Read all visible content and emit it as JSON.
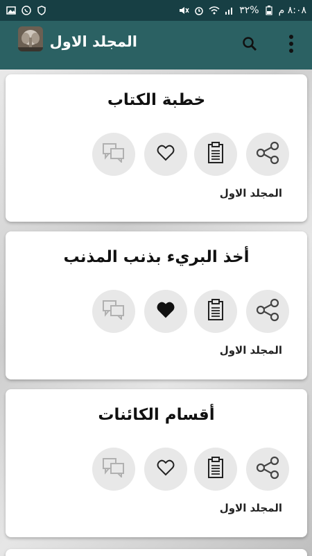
{
  "status_bar": {
    "time": "٨:٠٨ م",
    "battery": "٣٢%",
    "left_icons": [
      "image-icon",
      "whatsapp-icon",
      "vpn-icon"
    ],
    "right_icons": [
      "signal-icon",
      "wifi-icon",
      "alarm-icon",
      "mute-icon"
    ]
  },
  "app_bar": {
    "title": "المجلد الاول",
    "menu_icon": "more-vert-icon",
    "search_icon": "search-icon"
  },
  "cards": [
    {
      "title": "خطبة الكتاب",
      "footer": "المجلد الاول",
      "favorite": false
    },
    {
      "title": "أخذ البريء بذنب المذنب",
      "footer": "المجلد الاول",
      "favorite": true
    },
    {
      "title": "أقسام الكائنات",
      "footer": "المجلد الاول",
      "favorite": false
    }
  ],
  "colors": {
    "status_bar": "#173f44",
    "app_bar": "#2b6163",
    "icon_gray": "#444444"
  }
}
